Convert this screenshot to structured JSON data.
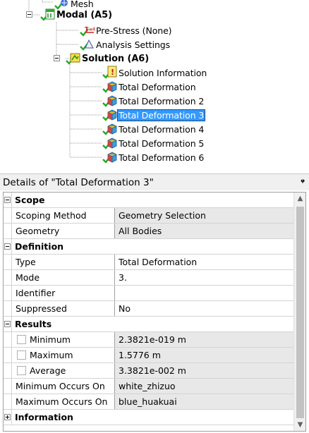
{
  "tree": {
    "nodes": [
      {
        "id": "mesh",
        "label": "Mesh",
        "icon": "mesh-icon",
        "bold": false,
        "selected": false
      },
      {
        "id": "modal",
        "label": "Modal (A5)",
        "icon": "modal-analysis-icon",
        "bold": true,
        "selected": false
      },
      {
        "id": "prestress",
        "label": "Pre-Stress (None)",
        "icon": "prestress-icon",
        "bold": false,
        "selected": false
      },
      {
        "id": "analysis-settings",
        "label": "Analysis Settings",
        "icon": "analysis-settings-icon",
        "bold": false,
        "selected": false
      },
      {
        "id": "solution",
        "label": "Solution (A6)",
        "icon": "solution-icon",
        "bold": true,
        "selected": false
      },
      {
        "id": "solution-info",
        "label": "Solution Information",
        "icon": "solution-information-icon",
        "bold": false,
        "selected": false
      },
      {
        "id": "td1",
        "label": "Total Deformation",
        "icon": "total-deformation-icon",
        "bold": false,
        "selected": false
      },
      {
        "id": "td2",
        "label": "Total Deformation 2",
        "icon": "total-deformation-icon",
        "bold": false,
        "selected": false
      },
      {
        "id": "td3",
        "label": "Total Deformation 3",
        "icon": "total-deformation-icon",
        "bold": false,
        "selected": true
      },
      {
        "id": "td4",
        "label": "Total Deformation 4",
        "icon": "total-deformation-icon",
        "bold": false,
        "selected": false
      },
      {
        "id": "td5",
        "label": "Total Deformation 5",
        "icon": "total-deformation-icon",
        "bold": false,
        "selected": false
      },
      {
        "id": "td6",
        "label": "Total Deformation 6",
        "icon": "total-deformation-icon",
        "bold": false,
        "selected": false
      }
    ]
  },
  "details": {
    "title": "Details of \"Total Deformation 3\"",
    "pin_glyph": "ᵖ",
    "rows": [
      {
        "kind": "group",
        "label": "Scope",
        "expanded": true
      },
      {
        "kind": "prop",
        "label": "Scoping Method",
        "value": "Geometry Selection",
        "shaded": true
      },
      {
        "kind": "prop",
        "label": "Geometry",
        "value": "All Bodies",
        "shaded": true
      },
      {
        "kind": "group",
        "label": "Definition",
        "expanded": true
      },
      {
        "kind": "prop",
        "label": "Type",
        "value": "Total Deformation",
        "shaded": false
      },
      {
        "kind": "prop",
        "label": "Mode",
        "value": "3.",
        "shaded": false
      },
      {
        "kind": "prop",
        "label": "Identifier",
        "value": "",
        "shaded": false
      },
      {
        "kind": "prop",
        "label": "Suppressed",
        "value": "No",
        "shaded": false
      },
      {
        "kind": "group",
        "label": "Results",
        "expanded": true
      },
      {
        "kind": "check",
        "label": "Minimum",
        "value": "2.3821e-019 m",
        "shaded": true
      },
      {
        "kind": "check",
        "label": "Maximum",
        "value": "1.5776 m",
        "shaded": true
      },
      {
        "kind": "check",
        "label": "Average",
        "value": "3.3821e-002 m",
        "shaded": true
      },
      {
        "kind": "prop",
        "label": "Minimum Occurs On",
        "value": "white_zhizuo",
        "shaded": true
      },
      {
        "kind": "prop",
        "label": "Maximum Occurs On",
        "value": "blue_huakuai",
        "shaded": true
      },
      {
        "kind": "group",
        "label": "Information",
        "expanded": false
      }
    ]
  },
  "colors": {
    "selection": "#3399ff",
    "check_green": "#22aa22",
    "shaded_cell": "#e8e8e8"
  }
}
